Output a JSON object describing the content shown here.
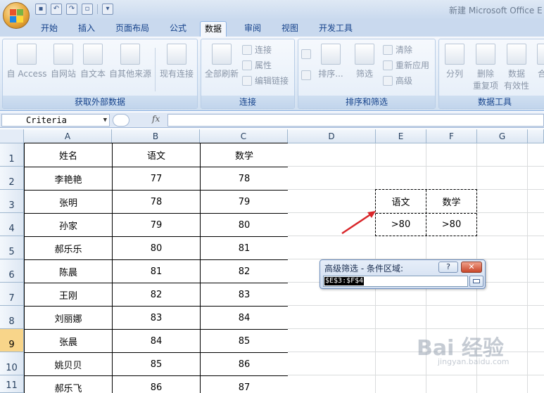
{
  "titlebar": {
    "title": "新建 Microsoft Office E"
  },
  "tabs": [
    {
      "label": "开始",
      "active": false
    },
    {
      "label": "插入",
      "active": false
    },
    {
      "label": "页面布局",
      "active": false
    },
    {
      "label": "公式",
      "active": false
    },
    {
      "label": "数据",
      "active": true
    },
    {
      "label": "审阅",
      "active": false
    },
    {
      "label": "视图",
      "active": false
    },
    {
      "label": "开发工具",
      "active": false
    }
  ],
  "ribbon": {
    "get_external": {
      "group_label": "获取外部数据",
      "access": "自 Access",
      "web": "自网站",
      "text": "自文本",
      "other": "自其他来源",
      "existing": "现有连接"
    },
    "connections": {
      "group_label": "连接",
      "refresh_all": "全部刷新",
      "connections": "连接",
      "properties": "属性",
      "edit_links": "编辑链接"
    },
    "sort_filter": {
      "group_label": "排序和筛选",
      "sort": "排序...",
      "filter": "筛选",
      "clear": "清除",
      "reapply": "重新应用",
      "advanced": "高级"
    },
    "data_tools": {
      "group_label": "数据工具",
      "text_to_columns": "分列",
      "remove_dup_1": "删除",
      "remove_dup_2": "重复项",
      "validation_1": "数据",
      "validation_2": "有效性",
      "more": "合"
    }
  },
  "formula_bar": {
    "name_box": "Criteria",
    "fx": "fx",
    "formula": ""
  },
  "columns": [
    "A",
    "B",
    "C",
    "D",
    "E",
    "F",
    "G"
  ],
  "rows": [
    "1",
    "2",
    "3",
    "4",
    "5",
    "6",
    "7",
    "8",
    "9",
    "10",
    "11"
  ],
  "selected_row": "9",
  "table": {
    "headers": [
      "姓名",
      "语文",
      "数学"
    ],
    "rows": [
      [
        "李艳艳",
        "77",
        "78"
      ],
      [
        "张明",
        "78",
        "79"
      ],
      [
        "孙家",
        "79",
        "80"
      ],
      [
        "郝乐乐",
        "80",
        "81"
      ],
      [
        "陈晨",
        "81",
        "82"
      ],
      [
        "王刚",
        "82",
        "83"
      ],
      [
        "刘丽娜",
        "83",
        "84"
      ],
      [
        "张晨",
        "84",
        "85"
      ],
      [
        "姚贝贝",
        "85",
        "86"
      ],
      [
        "郝乐飞",
        "86",
        "87"
      ]
    ]
  },
  "criteria": {
    "headers": [
      "语文",
      "数学"
    ],
    "values": [
      ">80",
      ">80"
    ]
  },
  "dialog": {
    "title": "高级筛选 - 条件区域:",
    "help": "?",
    "close": "✕",
    "input_value": "$E$3:$F$4"
  },
  "watermark": {
    "text": "Bai 经验",
    "sub": "jingyan.baidu.com"
  },
  "colors": {
    "accent": "#15428b",
    "selected_row": "#f8d58a",
    "arrow": "#d9262a"
  }
}
